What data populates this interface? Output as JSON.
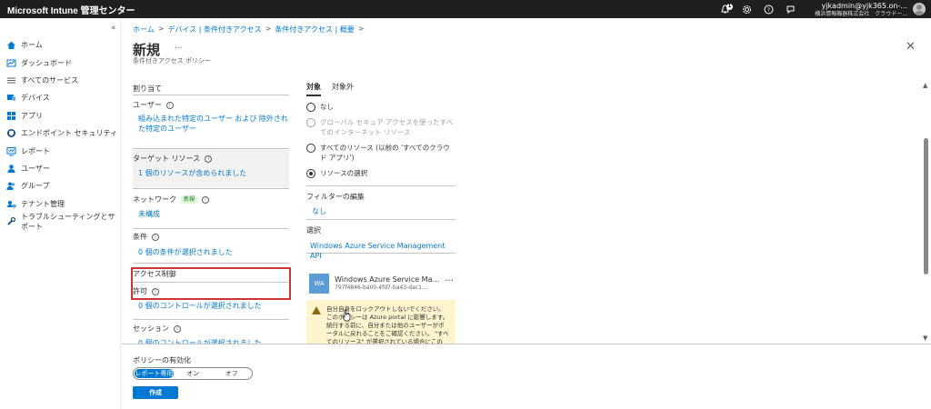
{
  "app": {
    "title": "Microsoft Intune 管理センター"
  },
  "topbar": {
    "notification_count": "1",
    "account_user": "yjkadmin@yjk365.on-...",
    "account_org": "横浜情報機器株式会社　クラウドー..."
  },
  "sidebar": {
    "collapse": "«",
    "items": [
      {
        "label": "ホーム",
        "icon": "home-icon"
      },
      {
        "label": "ダッシュボード",
        "icon": "dashboard-icon"
      },
      {
        "label": "すべてのサービス",
        "icon": "list-icon"
      },
      {
        "label": "デバイス",
        "icon": "devices-icon"
      },
      {
        "label": "アプリ",
        "icon": "apps-icon"
      },
      {
        "label": "エンドポイント セキュリティ",
        "icon": "shield-icon"
      },
      {
        "label": "レポート",
        "icon": "report-icon"
      },
      {
        "label": "ユーザー",
        "icon": "user-icon"
      },
      {
        "label": "グループ",
        "icon": "group-icon"
      },
      {
        "label": "テナント管理",
        "icon": "tenant-icon"
      },
      {
        "label": "トラブルシューティングとサポート",
        "icon": "wrench-icon"
      }
    ]
  },
  "breadcrumb": [
    "ホーム",
    "デバイス | 条件付きアクセス",
    "条件付きアクセス | 概要"
  ],
  "page": {
    "title": "新規",
    "more": "...",
    "subtitle": "条件付きアクセス ポリシー",
    "close": "✕"
  },
  "assignments": {
    "heading": "割り当て",
    "users_label": "ユーザー",
    "users_value": "組み込まれた特定のユーザー および 除外された特定のユーザー",
    "target_label": "ターゲット リソース",
    "target_value": "1 個のリソースが含められました",
    "network_label": "ネットワーク",
    "network_badge": "新規",
    "network_value": "未構成",
    "conditions_label": "条件",
    "conditions_value": "0 個の条件が選択されました",
    "access_heading": "アクセス制御",
    "grant_label": "許可",
    "grant_value": "0 個のコントロールが選択されました",
    "session_label": "セッション",
    "session_value": "0 個のコントロールが選択されました"
  },
  "targeting": {
    "tab_include": "対象",
    "tab_exclude": "対象外",
    "options": [
      {
        "label": "なし",
        "checked": false,
        "disabled": false
      },
      {
        "label": "グローバル セキュア アクセスを使ったすべてのインターネット リソース",
        "checked": false,
        "disabled": true
      },
      {
        "label": "すべてのリソース (以前の 'すべてのクラウド アプリ')",
        "checked": false,
        "disabled": false
      },
      {
        "label": "リソースの選択",
        "checked": true,
        "disabled": false
      }
    ],
    "filter_label": "フィルターの編集",
    "filter_value": "なし",
    "select_label": "選択",
    "select_value": "Windows Azure Service Management API",
    "resource_logo": "WA",
    "resource_name": "Windows Azure Service Ma...",
    "resource_id": "797f4846-ba00-4fd7-ba43-dac1...",
    "resource_more": "···",
    "warning": "自分自身をロックアウトしないでください。このポリシーは Azure portal に影響します。続行する前に、自分または他のユーザーがポータルに戻れることをご確認ください。 \"すべてのリソース\" が選択されている場合にこの"
  },
  "footer": {
    "policy_enable_label": "ポリシーの有効化",
    "toggle": [
      {
        "label": "レポート専用",
        "active": true
      },
      {
        "label": "オン",
        "active": false
      },
      {
        "label": "オフ",
        "active": false
      }
    ],
    "create_label": "作成"
  },
  "colors": {
    "accent": "#0078d4",
    "highlight": "#d13438",
    "topbar": "#1f1f1f"
  }
}
